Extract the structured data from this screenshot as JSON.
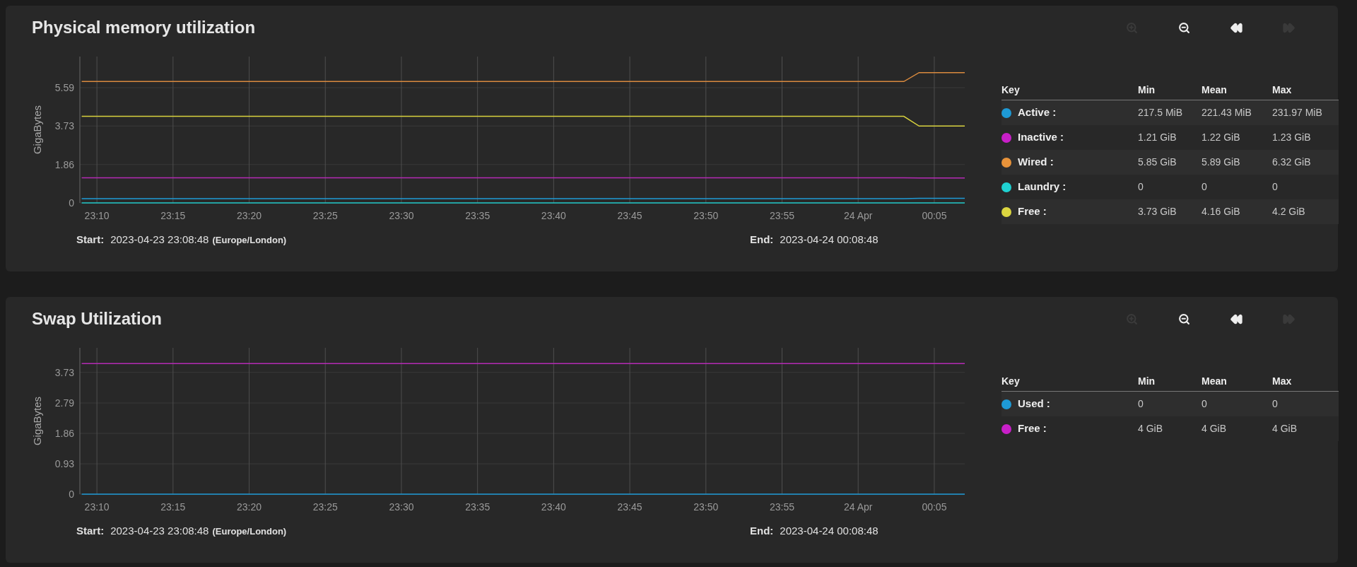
{
  "panels": [
    {
      "title": "Physical memory utilization",
      "toolbar": [
        {
          "kind": "zoom_in",
          "disabled": true
        },
        {
          "kind": "zoom_out",
          "disabled": false
        },
        {
          "kind": "rewind",
          "disabled": false
        },
        {
          "kind": "forward",
          "disabled": true
        }
      ],
      "chart_data": {
        "type": "line",
        "grid": true,
        "ylabel": "GigaBytes",
        "ylim": [
          0,
          7.1
        ],
        "categories": [
          null,
          "23:10",
          null,
          null,
          null,
          null,
          "23:15",
          null,
          null,
          null,
          null,
          "23:20",
          null,
          null,
          null,
          null,
          "23:25",
          null,
          null,
          null,
          null,
          "23:30",
          null,
          null,
          null,
          null,
          "23:35",
          null,
          null,
          null,
          null,
          "23:40",
          null,
          null,
          null,
          null,
          "23:45",
          null,
          null,
          null,
          null,
          "23:50",
          null,
          null,
          null,
          null,
          "23:55",
          null,
          null,
          null,
          null,
          "24 Apr",
          null,
          null,
          null,
          null,
          "00:05",
          null,
          null
        ],
        "yticks": [
          {
            "value": 0,
            "label": "0"
          },
          {
            "value": 1.86,
            "label": "1.86"
          },
          {
            "value": 3.73,
            "label": "3.73"
          },
          {
            "value": 5.59,
            "label": "5.59"
          }
        ],
        "series": [
          {
            "name": "Active",
            "color": "#1e9ad6",
            "values": [
              0.21,
              0.21,
              0.21,
              0.21,
              0.21,
              0.21,
              0.21,
              0.21,
              0.21,
              0.21,
              0.21,
              0.21,
              0.21,
              0.21,
              0.21,
              0.21,
              0.21,
              0.21,
              0.21,
              0.21,
              0.21,
              0.21,
              0.21,
              0.21,
              0.21,
              0.21,
              0.21,
              0.21,
              0.21,
              0.21,
              0.21,
              0.21,
              0.21,
              0.21,
              0.21,
              0.21,
              0.21,
              0.21,
              0.21,
              0.21,
              0.21,
              0.21,
              0.21,
              0.21,
              0.21,
              0.21,
              0.21,
              0.21,
              0.21,
              0.21,
              0.21,
              0.21,
              0.21,
              0.21,
              0.21,
              0.22,
              0.22,
              0.22,
              0.22
            ]
          },
          {
            "name": "Inactive",
            "color": "#b52ab5",
            "values": [
              1.22,
              1.22,
              1.22,
              1.22,
              1.22,
              1.22,
              1.22,
              1.22,
              1.22,
              1.22,
              1.22,
              1.22,
              1.22,
              1.22,
              1.22,
              1.22,
              1.22,
              1.22,
              1.22,
              1.22,
              1.22,
              1.22,
              1.22,
              1.22,
              1.22,
              1.22,
              1.22,
              1.22,
              1.22,
              1.22,
              1.22,
              1.22,
              1.22,
              1.22,
              1.22,
              1.22,
              1.22,
              1.22,
              1.22,
              1.22,
              1.22,
              1.22,
              1.22,
              1.22,
              1.22,
              1.22,
              1.22,
              1.22,
              1.22,
              1.22,
              1.22,
              1.22,
              1.22,
              1.22,
              1.22,
              1.21,
              1.21,
              1.21,
              1.21
            ]
          },
          {
            "name": "Wired",
            "color": "#d98a3e",
            "values": [
              5.89,
              5.89,
              5.89,
              5.89,
              5.89,
              5.89,
              5.89,
              5.89,
              5.89,
              5.89,
              5.89,
              5.89,
              5.89,
              5.89,
              5.89,
              5.89,
              5.89,
              5.89,
              5.89,
              5.89,
              5.89,
              5.89,
              5.89,
              5.89,
              5.89,
              5.89,
              5.89,
              5.89,
              5.89,
              5.89,
              5.89,
              5.89,
              5.89,
              5.89,
              5.89,
              5.89,
              5.89,
              5.89,
              5.89,
              5.89,
              5.89,
              5.89,
              5.89,
              5.89,
              5.89,
              5.89,
              5.89,
              5.89,
              5.89,
              5.89,
              5.89,
              5.89,
              5.89,
              5.89,
              5.89,
              6.32,
              6.32,
              6.32,
              6.32
            ]
          },
          {
            "name": "Laundry",
            "color": "#1fc8c8",
            "values": [
              0,
              0,
              0,
              0,
              0,
              0,
              0,
              0,
              0,
              0,
              0,
              0,
              0,
              0,
              0,
              0,
              0,
              0,
              0,
              0,
              0,
              0,
              0,
              0,
              0,
              0,
              0,
              0,
              0,
              0,
              0,
              0,
              0,
              0,
              0,
              0,
              0,
              0,
              0,
              0,
              0,
              0,
              0,
              0,
              0,
              0,
              0,
              0,
              0,
              0,
              0,
              0,
              0,
              0,
              0,
              0,
              0,
              0,
              0
            ]
          },
          {
            "name": "Free",
            "color": "#d8d23e",
            "values": [
              4.2,
              4.2,
              4.2,
              4.2,
              4.2,
              4.2,
              4.2,
              4.2,
              4.2,
              4.2,
              4.2,
              4.2,
              4.2,
              4.2,
              4.2,
              4.2,
              4.2,
              4.2,
              4.2,
              4.2,
              4.2,
              4.2,
              4.2,
              4.2,
              4.2,
              4.2,
              4.2,
              4.2,
              4.2,
              4.2,
              4.2,
              4.2,
              4.2,
              4.2,
              4.2,
              4.2,
              4.2,
              4.2,
              4.2,
              4.2,
              4.2,
              4.2,
              4.2,
              4.2,
              4.2,
              4.2,
              4.2,
              4.2,
              4.2,
              4.2,
              4.2,
              4.2,
              4.2,
              4.2,
              4.2,
              3.73,
              3.73,
              3.73,
              3.73
            ]
          }
        ]
      },
      "range": {
        "start_label": "Start:",
        "start": "2023-04-23 23:08:48",
        "timezone": "(Europe/London)",
        "end_label": "End:",
        "end": "2023-04-24 00:08:48"
      },
      "legend": {
        "columns": [
          "Key",
          "Min",
          "Mean",
          "Max"
        ],
        "key_suffix": ":",
        "rows": [
          {
            "color": "#1e9ad6",
            "min": "217.5 MiB",
            "mean": "221.43 MiB",
            "max": "231.97 MiB"
          },
          {
            "color": "#c81fc8",
            "min": "1.21 GiB",
            "mean": "1.22 GiB",
            "max": "1.23 GiB"
          },
          {
            "color": "#e8933a",
            "min": "5.85 GiB",
            "mean": "5.89 GiB",
            "max": "6.32 GiB"
          },
          {
            "color": "#1fd1d1",
            "min": "0",
            "mean": "0",
            "max": "0"
          },
          {
            "color": "#dcd640",
            "min": "3.73 GiB",
            "mean": "4.16 GiB",
            "max": "4.2 GiB"
          }
        ]
      }
    },
    {
      "title": "Swap Utilization",
      "toolbar": [
        {
          "kind": "zoom_in",
          "disabled": true
        },
        {
          "kind": "zoom_out",
          "disabled": false
        },
        {
          "kind": "rewind",
          "disabled": false
        },
        {
          "kind": "forward",
          "disabled": true
        }
      ],
      "chart_data": {
        "type": "line",
        "grid": true,
        "ylabel": "GigaBytes",
        "ylim": [
          0,
          4.48
        ],
        "categories": [
          null,
          "23:10",
          null,
          null,
          null,
          null,
          "23:15",
          null,
          null,
          null,
          null,
          "23:20",
          null,
          null,
          null,
          null,
          "23:25",
          null,
          null,
          null,
          null,
          "23:30",
          null,
          null,
          null,
          null,
          "23:35",
          null,
          null,
          null,
          null,
          "23:40",
          null,
          null,
          null,
          null,
          "23:45",
          null,
          null,
          null,
          null,
          "23:50",
          null,
          null,
          null,
          null,
          "23:55",
          null,
          null,
          null,
          null,
          "24 Apr",
          null,
          null,
          null,
          null,
          "00:05",
          null,
          null
        ],
        "yticks": [
          {
            "value": 0,
            "label": "0"
          },
          {
            "value": 0.93,
            "label": "0.93"
          },
          {
            "value": 1.86,
            "label": "1.86"
          },
          {
            "value": 2.79,
            "label": "2.79"
          },
          {
            "value": 3.73,
            "label": "3.73"
          }
        ],
        "series": [
          {
            "name": "Used",
            "color": "#1e9ad6",
            "values": [
              0,
              0,
              0,
              0,
              0,
              0,
              0,
              0,
              0,
              0,
              0,
              0,
              0,
              0,
              0,
              0,
              0,
              0,
              0,
              0,
              0,
              0,
              0,
              0,
              0,
              0,
              0,
              0,
              0,
              0,
              0,
              0,
              0,
              0,
              0,
              0,
              0,
              0,
              0,
              0,
              0,
              0,
              0,
              0,
              0,
              0,
              0,
              0,
              0,
              0,
              0,
              0,
              0,
              0,
              0,
              0,
              0,
              0,
              0
            ]
          },
          {
            "name": "Free",
            "color": "#b52ab5",
            "values": [
              4,
              4,
              4,
              4,
              4,
              4,
              4,
              4,
              4,
              4,
              4,
              4,
              4,
              4,
              4,
              4,
              4,
              4,
              4,
              4,
              4,
              4,
              4,
              4,
              4,
              4,
              4,
              4,
              4,
              4,
              4,
              4,
              4,
              4,
              4,
              4,
              4,
              4,
              4,
              4,
              4,
              4,
              4,
              4,
              4,
              4,
              4,
              4,
              4,
              4,
              4,
              4,
              4,
              4,
              4,
              4,
              4,
              4,
              4
            ]
          }
        ]
      },
      "range": {
        "start_label": "Start:",
        "start": "2023-04-23 23:08:48",
        "timezone": "(Europe/London)",
        "end_label": "End:",
        "end": "2023-04-24 00:08:48"
      },
      "legend": {
        "columns": [
          "Key",
          "Min",
          "Mean",
          "Max"
        ],
        "key_suffix": ":",
        "rows": [
          {
            "color": "#1e9ad6",
            "min": "0",
            "mean": "0",
            "max": "0"
          },
          {
            "color": "#c81fc8",
            "min": "4 GiB",
            "mean": "4 GiB",
            "max": "4 GiB"
          }
        ]
      }
    }
  ]
}
